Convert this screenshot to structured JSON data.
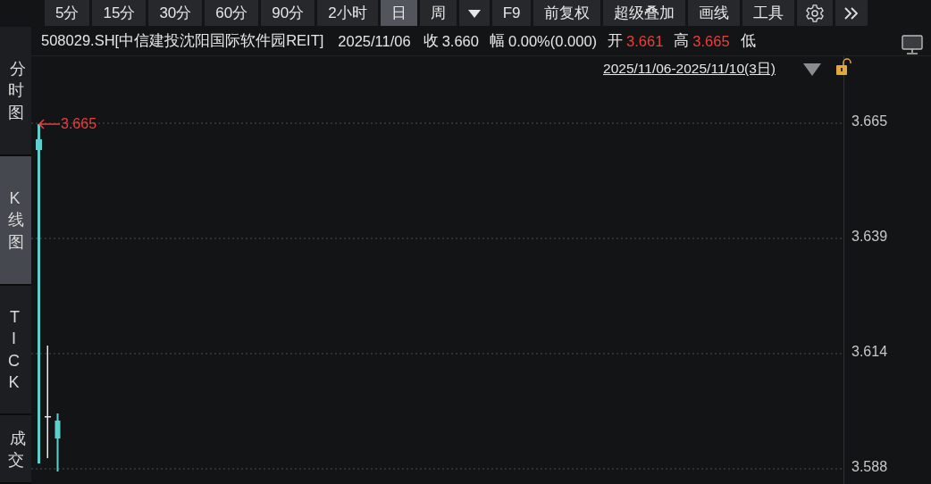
{
  "toolbar": {
    "periods": [
      {
        "label": "5分",
        "selected": false
      },
      {
        "label": "15分",
        "selected": false
      },
      {
        "label": "30分",
        "selected": false
      },
      {
        "label": "60分",
        "selected": false
      },
      {
        "label": "90分",
        "selected": false
      },
      {
        "label": "2小时",
        "selected": false
      },
      {
        "label": "日",
        "selected": true
      },
      {
        "label": "周",
        "selected": false
      }
    ],
    "tools": [
      {
        "kind": "dropdown"
      },
      {
        "kind": "text",
        "label": "F9"
      },
      {
        "kind": "text",
        "label": "前复权"
      },
      {
        "kind": "text",
        "label": "超级叠加"
      },
      {
        "kind": "text",
        "label": "画线"
      },
      {
        "kind": "text",
        "label": "工具"
      },
      {
        "kind": "settings"
      },
      {
        "kind": "more"
      }
    ]
  },
  "info": {
    "code": "508029.SH[中信建投沈阳国际软件园REIT]",
    "date": "2025/11/06",
    "fields": [
      {
        "label": "收",
        "value": "3.660",
        "color": "#e6e6e6"
      },
      {
        "label": "幅",
        "value": "0.00%(0.000)",
        "color": "#e6e6e6"
      },
      {
        "label": "开",
        "value": "3.661",
        "color": "#ec3f3c"
      },
      {
        "label": "高",
        "value": "3.665",
        "color": "#ec3f3c"
      }
    ],
    "trailing_label": "低"
  },
  "side_tabs": [
    {
      "label": "分时图",
      "selected": false
    },
    {
      "label": "K线图",
      "selected": true
    },
    {
      "label": "TICK",
      "selected": false
    },
    {
      "label": "成交",
      "selected": false
    }
  ],
  "chart": {
    "range": "2025/11/06-2025/11/10(3日)",
    "high_marker": "3.665",
    "axis_labels": [
      "3.665",
      "3.639",
      "3.614",
      "3.588"
    ]
  }
}
